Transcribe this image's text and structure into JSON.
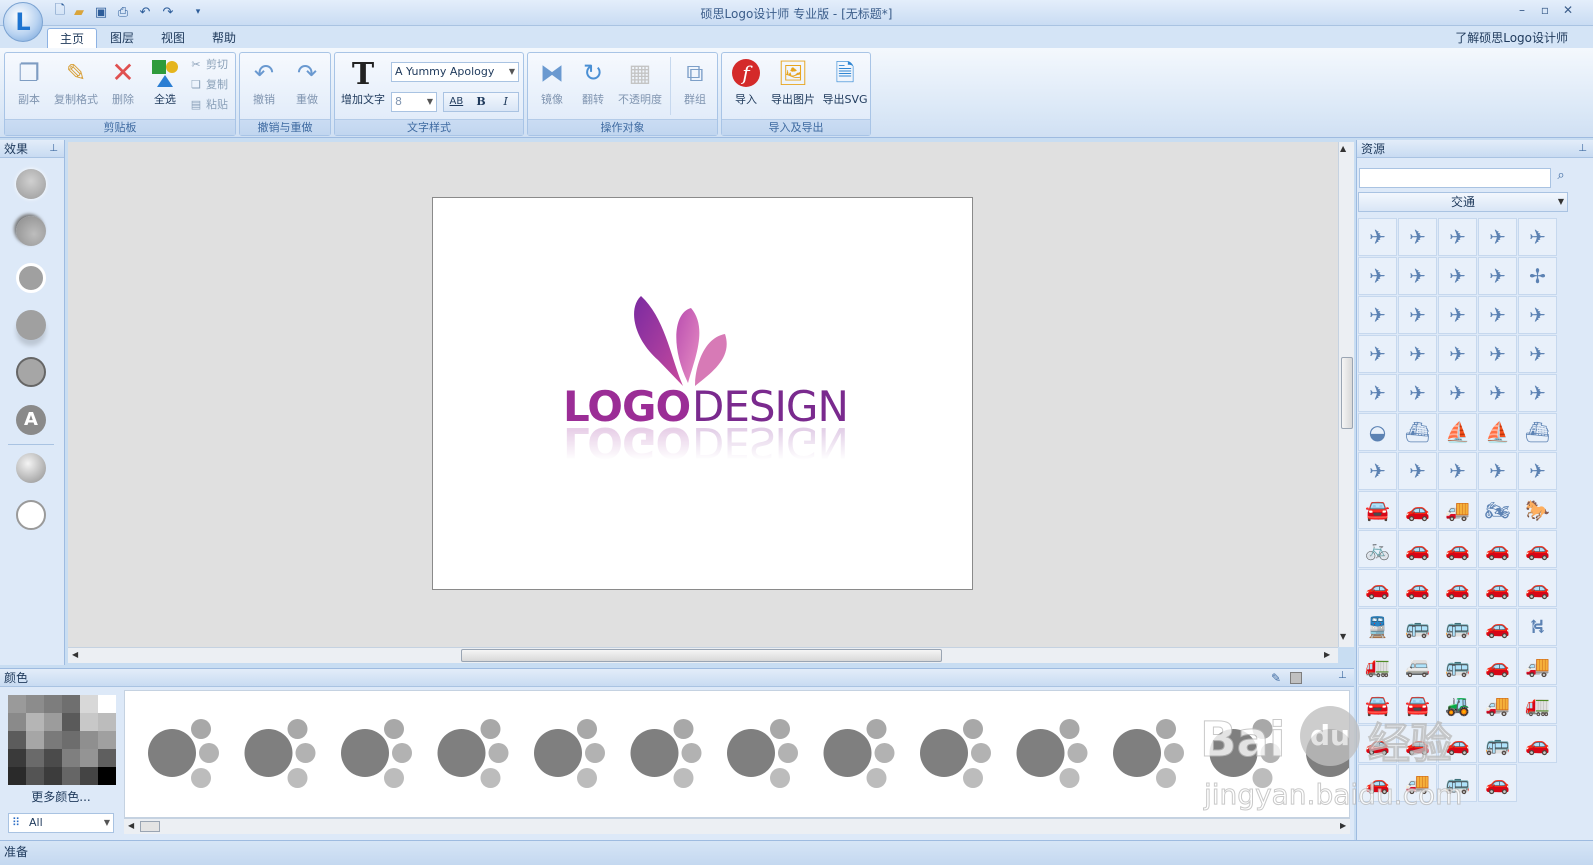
{
  "window": {
    "title": "硕思Logo设计师 专业版 - [无标题*]"
  },
  "quick_access": {
    "icons": [
      "new-icon",
      "open-icon",
      "save-icon",
      "print-icon",
      "undo-icon",
      "redo-icon",
      "customize-icon"
    ]
  },
  "tabs": [
    {
      "label": "主页",
      "active": true
    },
    {
      "label": "图层",
      "active": false
    },
    {
      "label": "视图",
      "active": false
    },
    {
      "label": "帮助",
      "active": false
    }
  ],
  "about_link": "了解硕思Logo设计师",
  "ribbon": {
    "clipboard": {
      "caption": "剪贴板",
      "copy": "副本",
      "format_painter": "复制格式",
      "delete": "删除",
      "select_all": "全选",
      "cut": "剪切",
      "copy_small": "复制",
      "paste": "粘贴"
    },
    "undo_redo": {
      "caption": "撤销与重做",
      "undo": "撤销",
      "redo": "重做"
    },
    "text_style": {
      "caption": "文字样式",
      "add_text": "增加文字",
      "font": "A Yummy Apology",
      "size": "8",
      "ab": "AB",
      "bold": "B",
      "italic": "I"
    },
    "operate": {
      "caption": "操作对象",
      "mirror": "镜像",
      "rotate": "翻转",
      "opacity": "不透明度",
      "group": "群组"
    },
    "import_export": {
      "caption": "导入及导出",
      "import": "导入",
      "export_image": "导出图片",
      "export_svg": "导出SVG"
    }
  },
  "effects_panel": {
    "title": "效果"
  },
  "logo": {
    "part1": "LOGO",
    "part2": "DESIGN"
  },
  "resource_panel": {
    "title": "资源",
    "search_placeholder": "",
    "category": "交通"
  },
  "color_panel": {
    "title": "颜色",
    "more_colors": "更多颜色...",
    "palette": "All"
  },
  "status": {
    "text": "准备"
  },
  "watermark": {
    "brand": "Bai",
    "du": "du",
    "jingyan": "经验",
    "url": "jingyan.baidu.com"
  },
  "colors": {
    "accent": "#1e74d0",
    "logo_purple": "#8e2f9b",
    "logo_magenta": "#b0368f",
    "icon_blue": "#5c82b3"
  }
}
